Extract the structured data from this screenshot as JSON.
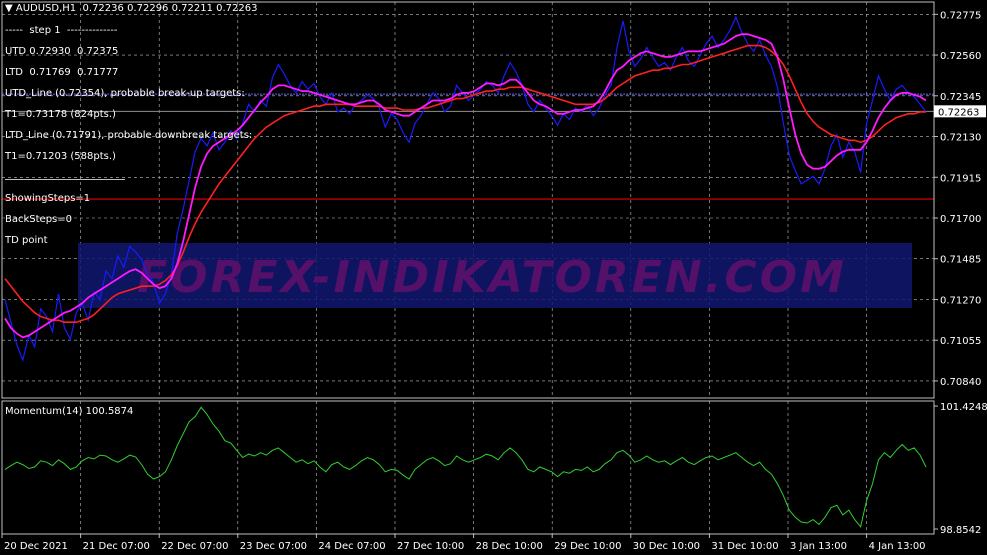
{
  "header": {
    "symbol": "AUDUSD,H1",
    "ohlc": "0.72236 0.72296 0.72211 0.72263"
  },
  "info_lines": {
    "step": "step 1",
    "utd": "UTD 0.72930  0.72375",
    "ltd": "LTD  0.71769  0.71777",
    "utd_line": "UTD_Line (0.72354), probable break-up targets:",
    "utd_t1": "T1=0.73178 (824pts.)",
    "ltd_line": "LTD_Line (0.71791), probable downbreak targets:",
    "ltd_t1": "T1=0.71203 (588pts.)",
    "showing_steps": "ShowingSteps=1",
    "back_steps": "BackSteps=0",
    "td_point": "TD point"
  },
  "watermark": "FOREX-INDIKATOREN.COM",
  "colors": {
    "background": "#000000",
    "grid": "#c0c0c0",
    "price": "#1a1aff",
    "fast_ma": "#ff1aff",
    "slow_ma": "#ff2020",
    "hline_red": "#c00000",
    "hline_blue": "#6060ff",
    "momentum": "#32cd32",
    "watermark_text": "#55106a",
    "watermark_band": "#101870"
  },
  "chart_data": [
    {
      "type": "line",
      "title": "AUDUSD,H1",
      "y_ticks": [
        "0.72775",
        "0.72560",
        "0.72345",
        "0.72130",
        "0.71915",
        "0.71700",
        "0.71485",
        "0.71270",
        "0.71055",
        "0.70840"
      ],
      "ylim": [
        0.7075,
        0.7284
      ],
      "current_price": "0.72263",
      "horizontal_lines": {
        "red": 0.718,
        "blue": 0.72354,
        "gray": 0.72263
      },
      "x_ticks": [
        "20 Dec 2021",
        "21 Dec 07:00",
        "22 Dec 07:00",
        "23 Dec 07:00",
        "24 Dec 07:00",
        "27 Dec 10:00",
        "28 Dec 10:00",
        "29 Dec 10:00",
        "30 Dec 10:00",
        "31 Dec 10:00",
        "3 Jan 13:00",
        "4 Jan 13:00"
      ],
      "grid": true,
      "series": [
        {
          "key": "price",
          "values": [
            0.7127,
            0.7115,
            0.7103,
            0.7095,
            0.7108,
            0.7102,
            0.7122,
            0.7118,
            0.711,
            0.713,
            0.7112,
            0.7106,
            0.712,
            0.7125,
            0.7116,
            0.7131,
            0.7127,
            0.7142,
            0.7138,
            0.715,
            0.7144,
            0.7155,
            0.7152,
            0.7148,
            0.714,
            0.7136,
            0.7125,
            0.713,
            0.714,
            0.7162,
            0.7175,
            0.719,
            0.7205,
            0.7212,
            0.7208,
            0.7215,
            0.7206,
            0.721,
            0.7216,
            0.7212,
            0.722,
            0.723,
            0.7226,
            0.7232,
            0.7229,
            0.7244,
            0.7251,
            0.7246,
            0.724,
            0.7236,
            0.7242,
            0.7238,
            0.7241,
            0.7234,
            0.723,
            0.7236,
            0.7226,
            0.7228,
            0.7225,
            0.723,
            0.7232,
            0.7235,
            0.7233,
            0.7228,
            0.7218,
            0.7225,
            0.7222,
            0.7215,
            0.721,
            0.722,
            0.7224,
            0.723,
            0.7236,
            0.7233,
            0.7226,
            0.7229,
            0.724,
            0.7236,
            0.7232,
            0.7235,
            0.7238,
            0.7242,
            0.724,
            0.7236,
            0.7245,
            0.7252,
            0.7247,
            0.724,
            0.723,
            0.7226,
            0.7232,
            0.7228,
            0.7224,
            0.7219,
            0.7225,
            0.7222,
            0.7228,
            0.7226,
            0.723,
            0.7224,
            0.7228,
            0.7235,
            0.724,
            0.726,
            0.7274,
            0.7258,
            0.725,
            0.7254,
            0.726,
            0.7255,
            0.725,
            0.7252,
            0.7248,
            0.7255,
            0.726,
            0.7253,
            0.725,
            0.7256,
            0.7262,
            0.7266,
            0.726,
            0.7264,
            0.7269,
            0.7276,
            0.7268,
            0.7262,
            0.7258,
            0.7264,
            0.7256,
            0.725,
            0.7239,
            0.722,
            0.7203,
            0.7195,
            0.7188,
            0.719,
            0.7192,
            0.7188,
            0.7196,
            0.7208,
            0.7214,
            0.7202,
            0.721,
            0.7205,
            0.7194,
            0.722,
            0.7232,
            0.7245,
            0.7238,
            0.7232,
            0.7238,
            0.724,
            0.7236,
            0.7234,
            0.723,
            0.7226
          ]
        },
        {
          "key": "fast_ma",
          "values": [
            0.7117,
            0.7112,
            0.7109,
            0.7107,
            0.7108,
            0.711,
            0.7112,
            0.7114,
            0.7116,
            0.7118,
            0.712,
            0.7121,
            0.7123,
            0.7125,
            0.7128,
            0.713,
            0.7132,
            0.7134,
            0.7136,
            0.7138,
            0.714,
            0.7142,
            0.7143,
            0.7141,
            0.7138,
            0.7135,
            0.7133,
            0.7134,
            0.7138,
            0.7146,
            0.7158,
            0.7172,
            0.7186,
            0.7197,
            0.7204,
            0.7208,
            0.721,
            0.7212,
            0.7214,
            0.7216,
            0.7219,
            0.7223,
            0.7227,
            0.7231,
            0.7234,
            0.7238,
            0.724,
            0.724,
            0.7239,
            0.7238,
            0.7237,
            0.7237,
            0.7236,
            0.7235,
            0.7234,
            0.7233,
            0.7232,
            0.7231,
            0.723,
            0.723,
            0.7231,
            0.7232,
            0.7232,
            0.723,
            0.7227,
            0.7226,
            0.7225,
            0.7224,
            0.7224,
            0.7226,
            0.7228,
            0.723,
            0.7232,
            0.7232,
            0.7232,
            0.7233,
            0.7235,
            0.7236,
            0.7236,
            0.7237,
            0.7239,
            0.7241,
            0.7241,
            0.724,
            0.7241,
            0.7243,
            0.7243,
            0.724,
            0.7236,
            0.7232,
            0.723,
            0.7229,
            0.7227,
            0.7225,
            0.7225,
            0.7226,
            0.7227,
            0.7227,
            0.7228,
            0.7229,
            0.7232,
            0.7237,
            0.7243,
            0.7248,
            0.725,
            0.7253,
            0.7255,
            0.7257,
            0.7258,
            0.7257,
            0.7256,
            0.7255,
            0.7255,
            0.7256,
            0.7257,
            0.7258,
            0.7258,
            0.7258,
            0.7259,
            0.726,
            0.7261,
            0.7262,
            0.7264,
            0.7266,
            0.7267,
            0.7267,
            0.7266,
            0.7265,
            0.7264,
            0.7262,
            0.7255,
            0.7243,
            0.7228,
            0.7214,
            0.7204,
            0.7198,
            0.7196,
            0.7196,
            0.7197,
            0.72,
            0.7203,
            0.7205,
            0.7206,
            0.7206,
            0.7206,
            0.721,
            0.7216,
            0.7223,
            0.7228,
            0.7232,
            0.7235,
            0.7236,
            0.7236,
            0.7235,
            0.7234,
            0.7232
          ]
        },
        {
          "key": "slow_ma",
          "values": [
            0.7138,
            0.7134,
            0.713,
            0.7126,
            0.7123,
            0.712,
            0.7118,
            0.7117,
            0.7116,
            0.7116,
            0.7115,
            0.7115,
            0.7115,
            0.7116,
            0.7117,
            0.7119,
            0.7122,
            0.7125,
            0.7128,
            0.713,
            0.7131,
            0.7132,
            0.7133,
            0.7134,
            0.7134,
            0.7134,
            0.7135,
            0.7137,
            0.714,
            0.7145,
            0.7152,
            0.716,
            0.7167,
            0.7173,
            0.7178,
            0.7183,
            0.7188,
            0.7192,
            0.7196,
            0.72,
            0.7204,
            0.7208,
            0.7212,
            0.7215,
            0.7218,
            0.722,
            0.7222,
            0.7224,
            0.7225,
            0.7226,
            0.7227,
            0.7228,
            0.7229,
            0.7229,
            0.723,
            0.723,
            0.723,
            0.723,
            0.723,
            0.7229,
            0.7229,
            0.7229,
            0.7229,
            0.7229,
            0.7228,
            0.7228,
            0.7228,
            0.7227,
            0.7227,
            0.7227,
            0.7228,
            0.7228,
            0.7229,
            0.723,
            0.7231,
            0.7232,
            0.7233,
            0.7233,
            0.7234,
            0.7235,
            0.7236,
            0.7237,
            0.7237,
            0.7238,
            0.7238,
            0.7239,
            0.7239,
            0.7239,
            0.7238,
            0.7237,
            0.7236,
            0.7235,
            0.7234,
            0.7233,
            0.7232,
            0.7231,
            0.723,
            0.723,
            0.723,
            0.723,
            0.7231,
            0.7233,
            0.7236,
            0.7239,
            0.7241,
            0.7243,
            0.7245,
            0.7246,
            0.7247,
            0.7248,
            0.7248,
            0.7249,
            0.7249,
            0.725,
            0.7251,
            0.7251,
            0.7252,
            0.7253,
            0.7254,
            0.7255,
            0.7256,
            0.7257,
            0.7258,
            0.7259,
            0.726,
            0.7261,
            0.7261,
            0.7261,
            0.726,
            0.7258,
            0.7255,
            0.7251,
            0.7245,
            0.7238,
            0.7231,
            0.7225,
            0.7221,
            0.7218,
            0.7216,
            0.7214,
            0.7213,
            0.7212,
            0.7211,
            0.7211,
            0.721,
            0.7211,
            0.7213,
            0.7216,
            0.7219,
            0.7221,
            0.7223,
            0.7224,
            0.7225,
            0.7225,
            0.7226,
            0.7226
          ]
        }
      ]
    },
    {
      "type": "line",
      "title": "Momentum(14) 100.5874",
      "y_ticks": [
        "101.4248",
        "98.8542"
      ],
      "ylim": [
        98.75,
        101.53
      ],
      "series": [
        {
          "key": "momentum",
          "values": [
            100.1,
            100.18,
            100.25,
            100.2,
            100.12,
            100.15,
            100.28,
            100.25,
            100.18,
            100.3,
            100.22,
            100.1,
            100.15,
            100.28,
            100.35,
            100.32,
            100.4,
            100.38,
            100.3,
            100.25,
            100.32,
            100.4,
            100.36,
            100.2,
            100.0,
            99.9,
            99.95,
            100.05,
            100.3,
            100.6,
            100.85,
            101.1,
            101.2,
            101.4,
            101.25,
            101.05,
            100.9,
            100.7,
            100.65,
            100.5,
            100.35,
            100.42,
            100.38,
            100.45,
            100.4,
            100.5,
            100.55,
            100.45,
            100.35,
            100.25,
            100.3,
            100.22,
            100.28,
            100.15,
            100.05,
            100.2,
            100.25,
            100.15,
            100.1,
            100.18,
            100.28,
            100.35,
            100.3,
            100.2,
            100.05,
            100.1,
            100.08,
            99.98,
            99.9,
            100.1,
            100.2,
            100.3,
            100.35,
            100.28,
            100.18,
            100.22,
            100.38,
            100.3,
            100.25,
            100.3,
            100.35,
            100.42,
            100.38,
            100.3,
            100.45,
            100.55,
            100.45,
            100.3,
            100.1,
            100.05,
            100.15,
            100.1,
            100.05,
            99.95,
            100.05,
            100.02,
            100.1,
            100.08,
            100.15,
            100.05,
            100.1,
            100.22,
            100.3,
            100.45,
            100.5,
            100.4,
            100.25,
            100.3,
            100.38,
            100.3,
            100.25,
            100.28,
            100.2,
            100.28,
            100.35,
            100.25,
            100.2,
            100.28,
            100.35,
            100.38,
            100.3,
            100.35,
            100.4,
            100.45,
            100.35,
            100.25,
            100.18,
            100.25,
            100.1,
            100.0,
            99.8,
            99.55,
            99.25,
            99.1,
            99.0,
            98.98,
            99.05,
            98.95,
            99.1,
            99.3,
            99.35,
            99.15,
            99.25,
            99.05,
            98.9,
            99.45,
            99.8,
            100.3,
            100.45,
            100.35,
            100.5,
            100.62,
            100.5,
            100.55,
            100.4,
            100.15
          ]
        }
      ]
    }
  ]
}
